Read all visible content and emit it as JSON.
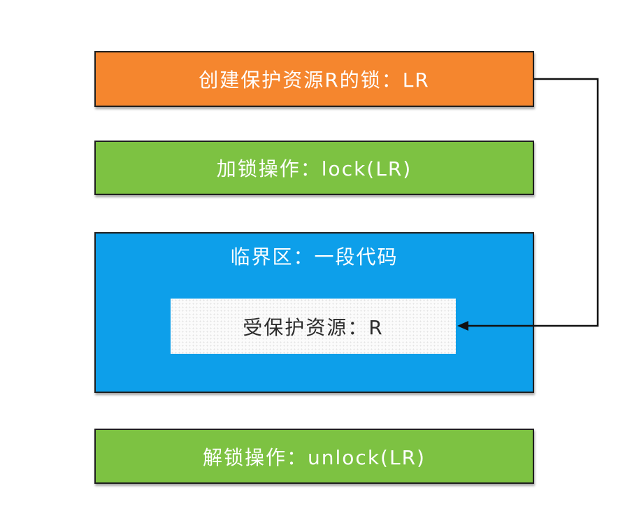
{
  "boxes": {
    "create_lock": "创建保护资源R的锁：LR",
    "lock_op": "加锁操作：lock(LR)",
    "critical_section": "临界区：一段代码",
    "protected_resource": "受保护资源：R",
    "unlock_op": "解锁操作：unlock(LR)"
  },
  "colors": {
    "create_lock": "#f5862e",
    "lock_ops": "#7dc242",
    "critical_section": "#0d9fea",
    "resource": "#fbfbfb"
  }
}
